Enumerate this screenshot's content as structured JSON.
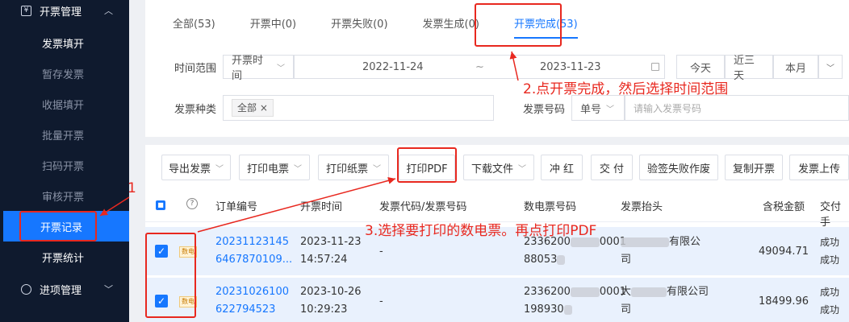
{
  "sidebar": {
    "group1": "开票管理",
    "items": [
      "发票填开",
      "暂存发票",
      "收据填开",
      "批量开票",
      "扫码开票",
      "审核开票",
      "开票记录",
      "开票统计"
    ],
    "group2": "进项管理"
  },
  "tabs": [
    "全部(53)",
    "开票中(0)",
    "开票失败(0)",
    "发票生成(0)",
    "开票完成(53)"
  ],
  "filters": {
    "time_label": "时间范围",
    "time_type": "开票时间",
    "start_date": "2022-11-24",
    "sep": "~",
    "end_date": "2023-11-23",
    "quick": [
      "今天",
      "近三天",
      "本月"
    ],
    "type_label": "发票种类",
    "type_value": "全部",
    "number_label": "发票号码",
    "number_type": "单号",
    "number_placeholder": "请输入发票号码"
  },
  "toolbar": [
    "导出发票",
    "打印电票",
    "打印纸票",
    "打印PDF",
    "下载文件",
    "冲 红",
    "交 付",
    "验签失败作废",
    "复制开票",
    "发票上传"
  ],
  "columns": [
    "订单编号",
    "开票时间",
    "发票代码/发票号码",
    "数电票号码",
    "发票抬头",
    "含税金额",
    "交付手"
  ],
  "rows": [
    {
      "tag": "数电",
      "order1": "20231123145",
      "order2": "6467870109...",
      "date": "2023-11-23",
      "time": "14:57:24",
      "code": "-",
      "num1": "2336200",
      "num1b": "0001",
      "num2": "88053",
      "title1": "有限公",
      "title2": "司",
      "amount": "49094.71",
      "status1": "成功",
      "status2": "成功"
    },
    {
      "tag": "数电",
      "order1": "20231026100",
      "order2": "622794523",
      "date": "2023-10-26",
      "time": "10:29:23",
      "code": "-",
      "num1": "2336200",
      "num1b": "0001",
      "num2": "198930",
      "title1": "大",
      "title1b": "有限公司",
      "title2": "司",
      "amount": "18499.96",
      "status1": "成功",
      "status2": "成功"
    }
  ],
  "annotations": {
    "step1": "1",
    "step2": "2.点开票完成，然后选择时间范围",
    "step3": "3.选择要打印的数电票。再点打印PDF"
  },
  "colors": {
    "accent": "#1677ff",
    "annotation": "#e8281f",
    "sidebar": "#0f1a2e"
  }
}
